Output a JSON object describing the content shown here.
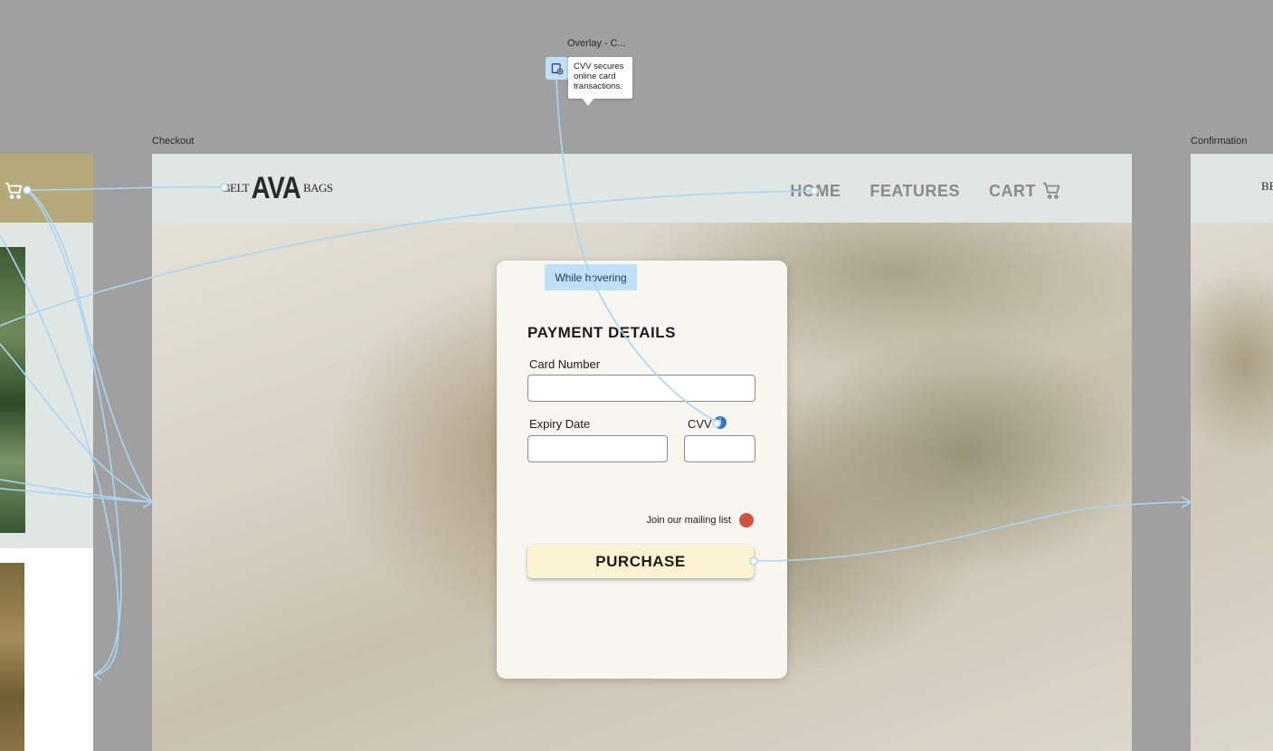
{
  "canvas": {
    "background": "#a0a0a0",
    "accent": "#bfe0f8",
    "connector_color": "#a9d6f5"
  },
  "frames": {
    "overlay_label": "Overlay - C...",
    "checkout_label": "Checkout",
    "confirmation_label": "Confirmation"
  },
  "overlay": {
    "icon": "overlay-frame-icon",
    "tooltip_text": "CVV secures online card transactions."
  },
  "header": {
    "logo_left": "BELT",
    "logo_main": "AVA",
    "logo_right": "BAGS",
    "nav": {
      "home": "HOME",
      "features": "FEATURES",
      "cart": "CART"
    },
    "cart_icon": "cart-icon"
  },
  "payment": {
    "interaction_tag": "While hovering",
    "title": "PAYMENT DETAILS",
    "card_number_label": "Card Number",
    "card_number_value": "",
    "expiry_label": "Expiry Date",
    "expiry_value": "",
    "cvv_label": "CVV",
    "cvv_value": "",
    "info_icon": "info-icon",
    "mailing_label": "Join our mailing list",
    "mailing_toggle_color": "#d0533e",
    "purchase_label": "PURCHASE"
  },
  "right_frame": {
    "logo_fragment": "BE"
  }
}
